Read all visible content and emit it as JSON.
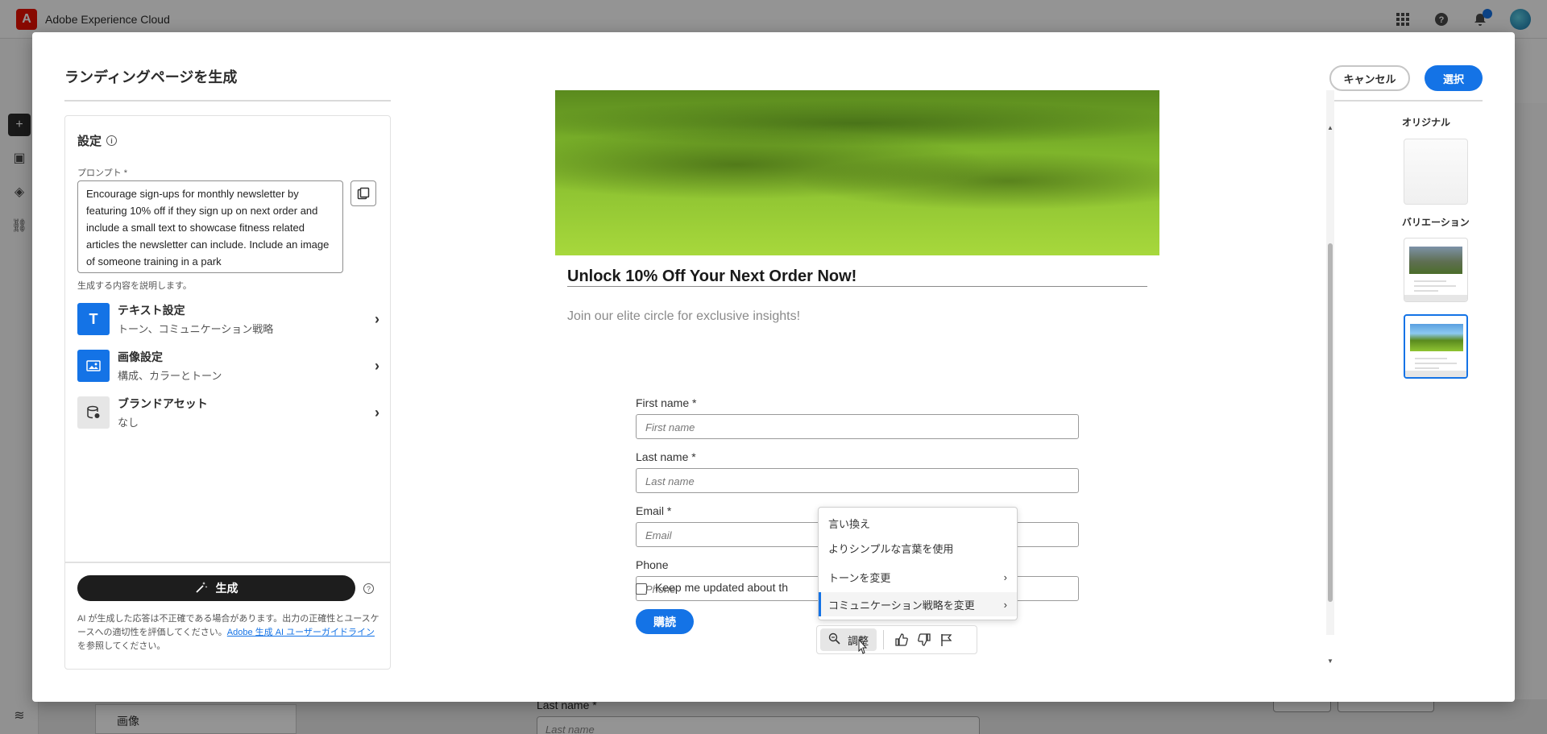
{
  "app": {
    "name": "Adobe Experience Cloud",
    "logo_letter": "A"
  },
  "modal": {
    "title": "ランディングページを生成",
    "cancel_label": "キャンセル",
    "select_label": "選択"
  },
  "settings": {
    "heading": "設定",
    "prompt_label": "プロンプト *",
    "prompt_text": "Encourage sign-ups for monthly newsletter by featuring 10% off if they sign up on next order and include a small text to showcase fitness related articles the newsletter can include. Include an image of someone training in a park",
    "prompt_help": "生成する内容を説明します。",
    "options": [
      {
        "title": "テキスト設定",
        "subtitle": "トーン、コミュニケーション戦略",
        "icon": "text-icon"
      },
      {
        "title": "画像設定",
        "subtitle": "構成、カラーとトーン",
        "icon": "image-icon"
      },
      {
        "title": "ブランドアセット",
        "subtitle": "なし",
        "icon": "brand-assets-icon"
      }
    ],
    "generate_label": "生成",
    "disclaimer_before": "AI が生成した応答は不正確である場合があります。出力の正確性とユースケースへの適切性を評価してください。",
    "disclaimer_link": "Adobe 生成 AI ユーザーガイドライン",
    "disclaimer_after": " を参照してください。"
  },
  "preview": {
    "headline": "Unlock 10% Off Your Next Order Now!",
    "subline": "Join our elite circle for exclusive insights!",
    "fields": [
      {
        "label": "First name *",
        "placeholder": "First name"
      },
      {
        "label": "Last name *",
        "placeholder": "Last name"
      },
      {
        "label": "Email *",
        "placeholder": "Email"
      },
      {
        "label": "Phone",
        "placeholder": "Phone"
      }
    ],
    "checkbox_label": "Keep me updated about th",
    "subscribe_label": "購読"
  },
  "context_menu": {
    "items": [
      {
        "label": "言い換え",
        "submenu": false
      },
      {
        "label": "よりシンプルな言葉を使用",
        "submenu": false
      },
      {
        "label": "トーンを変更",
        "submenu": true
      },
      {
        "label": "コミュニケーション戦略を変更",
        "submenu": true
      }
    ],
    "active_index": 3
  },
  "toolbar": {
    "adjust_label": "調整"
  },
  "variations": {
    "original_label": "オリジナル",
    "variations_label": "バリエーション",
    "selected_index": 1
  },
  "background": {
    "bottom_item_label": "画像",
    "lastname_label": "Last name *",
    "lastname_placeholder": "Last name"
  },
  "colors": {
    "accent": "#1473e6",
    "adobe_red": "#eb1000",
    "generate_bg": "#1d1d1d"
  }
}
